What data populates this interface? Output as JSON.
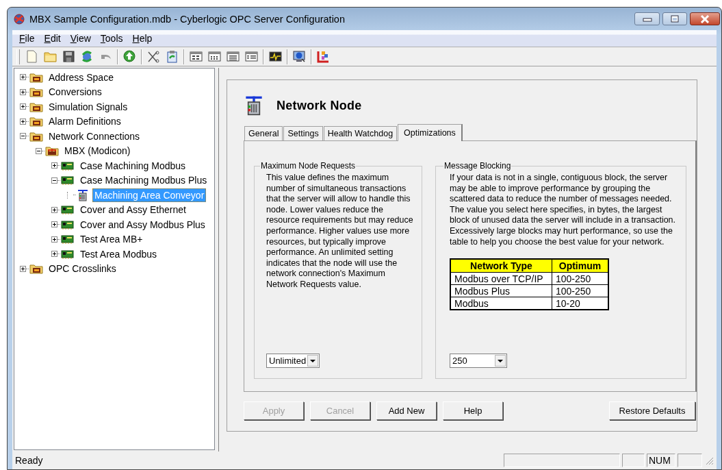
{
  "window": {
    "title": "MBX Sample Configuration.mdb - Cyberlogic OPC Server Configuration"
  },
  "menu": [
    "File",
    "Edit",
    "View",
    "Tools",
    "Help"
  ],
  "tree": [
    {
      "label": "Address Space",
      "kind": "folder",
      "expanded": false,
      "selected": false
    },
    {
      "label": "Conversions",
      "kind": "folder",
      "expanded": false,
      "selected": false
    },
    {
      "label": "Simulation Signals",
      "kind": "folder",
      "expanded": false,
      "selected": false
    },
    {
      "label": "Alarm Definitions",
      "kind": "folder",
      "expanded": false,
      "selected": false
    },
    {
      "label": "Network Connections",
      "kind": "folder",
      "expanded": true,
      "selected": false,
      "children": [
        {
          "label": "MBX (Modicon)",
          "kind": "network",
          "expanded": true,
          "selected": false,
          "children": [
            {
              "label": "Case Machining Modbus",
              "kind": "device",
              "expanded": false,
              "selected": false
            },
            {
              "label": "Case Machining Modbus Plus",
              "kind": "device",
              "expanded": true,
              "selected": false,
              "children": [
                {
                  "label": "Machining Area Conveyor",
                  "kind": "node",
                  "selected": true
                }
              ]
            },
            {
              "label": "Cover and Assy Ethernet",
              "kind": "device",
              "expanded": false,
              "selected": false
            },
            {
              "label": "Cover and Assy Modbus Plus",
              "kind": "device",
              "expanded": false,
              "selected": false
            },
            {
              "label": "Test Area MB+",
              "kind": "device",
              "expanded": false,
              "selected": false
            },
            {
              "label": "Test Area Modbus",
              "kind": "device",
              "expanded": false,
              "selected": false
            }
          ]
        }
      ]
    },
    {
      "label": "OPC Crosslinks",
      "kind": "folder",
      "expanded": false,
      "selected": false
    }
  ],
  "panel": {
    "title": "Network Node",
    "tabs": [
      {
        "label": "General",
        "selected": false
      },
      {
        "label": "Settings",
        "selected": false
      },
      {
        "label": "Health Watchdog",
        "selected": false
      },
      {
        "label": "Optimizations",
        "selected": true
      }
    ],
    "groups": [
      {
        "title": "Maximum Node Requests",
        "text": "This value defines the maximum number of simultaneous transactions that the server will allow to handle this node. Lower values reduce the resource requirements but may reduce performance. Higher values use more resources, but typically improve performance. An unlimited setting indicates that the node will use the network connection's Maximum Network Requests value.",
        "dropdown": {
          "value": "Unlimited"
        }
      },
      {
        "title": "Message Blocking",
        "text": "If your data is not in a single, contiguous block, the server may be able to improve performance by grouping the scattered data to reduce the number of messages needed. The value you select here specifies, in bytes, the largest block of unused data the server will include in a transaction. Excessively large blocks may hurt performance, so use the table to help you choose the best value for your network.",
        "table": {
          "columns": [
            "Network Type",
            "Optimum"
          ],
          "rows": [
            [
              "Modbus over TCP/IP",
              "100-250"
            ],
            [
              "Modbus Plus",
              "100-250"
            ],
            [
              "Modbus",
              "10-20"
            ]
          ]
        },
        "dropdown": {
          "value": "250"
        }
      }
    ],
    "buttons": [
      {
        "label": "Apply",
        "disabled": true
      },
      {
        "label": "Cancel",
        "disabled": true
      },
      {
        "label": "Add New",
        "disabled": false
      },
      {
        "label": "Help",
        "disabled": false
      },
      {
        "label": "Restore Defaults",
        "disabled": false
      }
    ]
  },
  "status_bar": {
    "text": "Ready",
    "indicator": "NUM"
  }
}
